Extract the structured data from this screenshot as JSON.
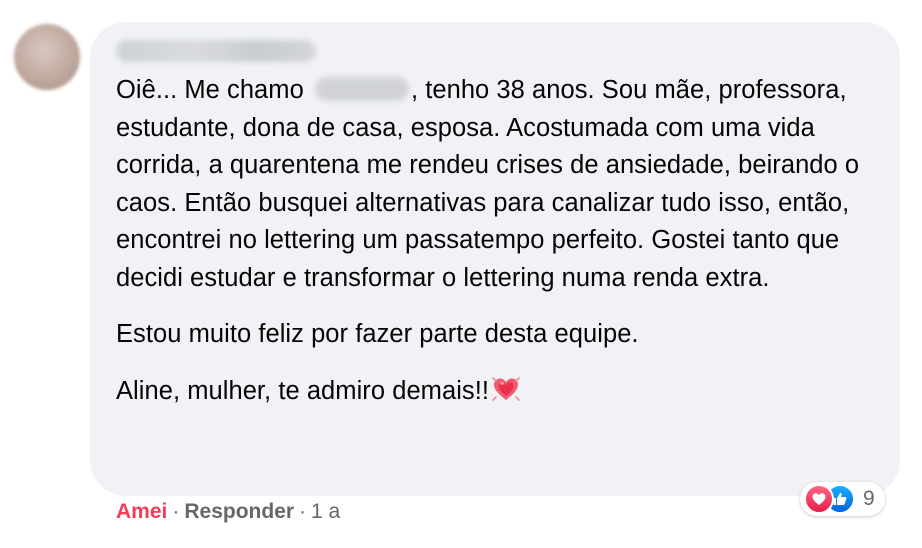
{
  "comment": {
    "author_avatar_icon": "avatar-blurred",
    "author_name_redacted": true,
    "paragraphs": {
      "p1_before_name": "Oiê... Me chamo ",
      "p1_after_name": ", tenho 38 anos. Sou mãe, professora, estudante, dona de casa, esposa. Acostumada com uma vida corrida, a quarentena me rendeu crises de ansiedade, beirando o caos. Então busquei alternativas para canalizar tudo isso, então, encontrei no lettering um passatempo perfeito. Gostei tanto que decidi estudar e transformar o lettering numa renda extra.",
      "p2": "Estou muito feliz por fazer parte desta equipe.",
      "p3": "Aline, mulher, te admiro demais!!"
    },
    "emoji_icon": "growing-heart-emoji"
  },
  "reactions": {
    "icons": [
      "love-reaction-icon",
      "like-reaction-icon"
    ],
    "count": "9",
    "love_color": "#f33e58",
    "like_color": "#0571ed"
  },
  "actions": {
    "love_label": "Amei",
    "separator": "·",
    "reply_label": "Responder",
    "time": "1 a"
  },
  "colors": {
    "bubble_bg": "#f0f2f5",
    "text": "#050505",
    "secondary_text": "#65676b"
  }
}
